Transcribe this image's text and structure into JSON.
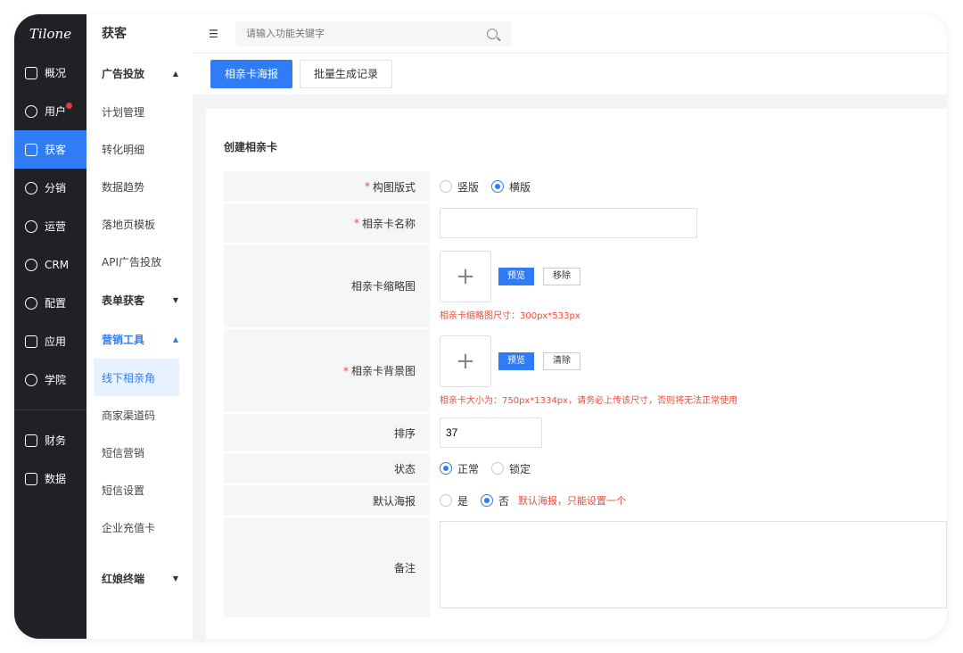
{
  "app": {
    "logo_text": "Tilone"
  },
  "left_nav": [
    {
      "label": "概况",
      "icon": "dashboard-icon"
    },
    {
      "label": "用户",
      "icon": "users-icon",
      "badge": true
    },
    {
      "label": "获客",
      "icon": "acquire-icon",
      "active": true
    },
    {
      "label": "分销",
      "icon": "distribute-icon"
    },
    {
      "label": "运营",
      "icon": "operate-icon"
    },
    {
      "label": "CRM",
      "icon": "crm-icon"
    },
    {
      "label": "配置",
      "icon": "settings-icon"
    },
    {
      "label": "应用",
      "icon": "apps-icon"
    },
    {
      "label": "学院",
      "icon": "academy-icon"
    },
    {
      "label": "财务",
      "icon": "finance-icon"
    },
    {
      "label": "数据",
      "icon": "data-icon"
    }
  ],
  "sub_nav": {
    "title": "获客",
    "groups": [
      {
        "label": "广告投放",
        "arrow": "▲",
        "items": [
          "计划管理",
          "转化明细",
          "数据趋势",
          "落地页模板",
          "API广告投放"
        ]
      },
      {
        "label": "表单获客",
        "arrow": "▼",
        "items": []
      },
      {
        "label": "营销工具",
        "arrow": "▲",
        "items": [
          "线下相亲角",
          "商家渠道码",
          "短信营销",
          "短信设置",
          "企业充值卡"
        ]
      },
      {
        "label": "红娘终端",
        "arrow": "▼",
        "items": []
      }
    ],
    "active_item": "线下相亲角"
  },
  "topbar": {
    "search_placeholder": "请输入功能关键字"
  },
  "tabs": [
    {
      "label": "相亲卡海报",
      "active": true
    },
    {
      "label": "批量生成记录",
      "active": false
    }
  ],
  "form": {
    "title": "创建相亲卡",
    "layout_label": "构图版式",
    "layout_options": [
      "竖版",
      "横版"
    ],
    "layout_selected": "横版",
    "name_label": "相亲卡名称",
    "name_value": "",
    "thumb_label": "相亲卡缩略图",
    "thumb_preview": "预览",
    "thumb_remove": "移除",
    "thumb_hint": "相亲卡缩略图尺寸：300px*533px",
    "bg_label": "相亲卡背景图",
    "bg_preview": "预览",
    "bg_clear": "清除",
    "bg_hint": "相亲卡大小为：750px*1334px，请务必上传该尺寸，否则将无法正常使用",
    "sort_label": "排序",
    "sort_value": "37",
    "status_label": "状态",
    "status_options": [
      "正常",
      "锁定"
    ],
    "status_selected": "正常",
    "default_label": "默认海报",
    "default_options": [
      "是",
      "否"
    ],
    "default_selected": "否",
    "default_hint": "默认海报，只能设置一个",
    "remark_label": "备注",
    "remark_value": "",
    "upload_plus": "+"
  }
}
